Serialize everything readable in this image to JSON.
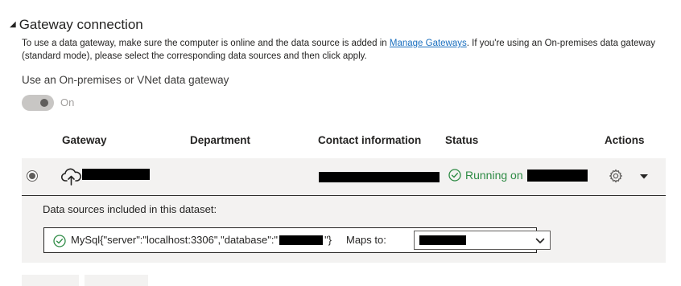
{
  "section": {
    "caret": "◢",
    "title": "Gateway connection"
  },
  "description": {
    "text_before": "To use a data gateway, make sure the computer is online and the data source is added in ",
    "link_text": "Manage Gateways",
    "text_after": ". If you're using an On-premises data gateway (standard mode), please select the corresponding data sources and then click apply."
  },
  "toggle": {
    "label": "Use an On-premises or VNet data gateway",
    "state_text": "On"
  },
  "table": {
    "headers": {
      "gateway": "Gateway",
      "department": "Department",
      "contact": "Contact information",
      "status": "Status",
      "actions": "Actions"
    },
    "row": {
      "status_text": "Running on",
      "icons": {
        "gateway": "cloud-upload-icon",
        "status": "check-circle-icon",
        "settings": "gear-icon",
        "expand": "chevron-down-icon"
      }
    }
  },
  "datasources": {
    "title": "Data sources included in this dataset:",
    "source_prefix": "MySql{\"server\":\"localhost:3306\",\"database\":\"",
    "source_suffix": "\"}",
    "maps_to_label": "Maps to:"
  },
  "colors": {
    "accent_link": "#1a6fbf",
    "status_green": "#2e8b45",
    "row_bg": "#f3f2f1"
  }
}
